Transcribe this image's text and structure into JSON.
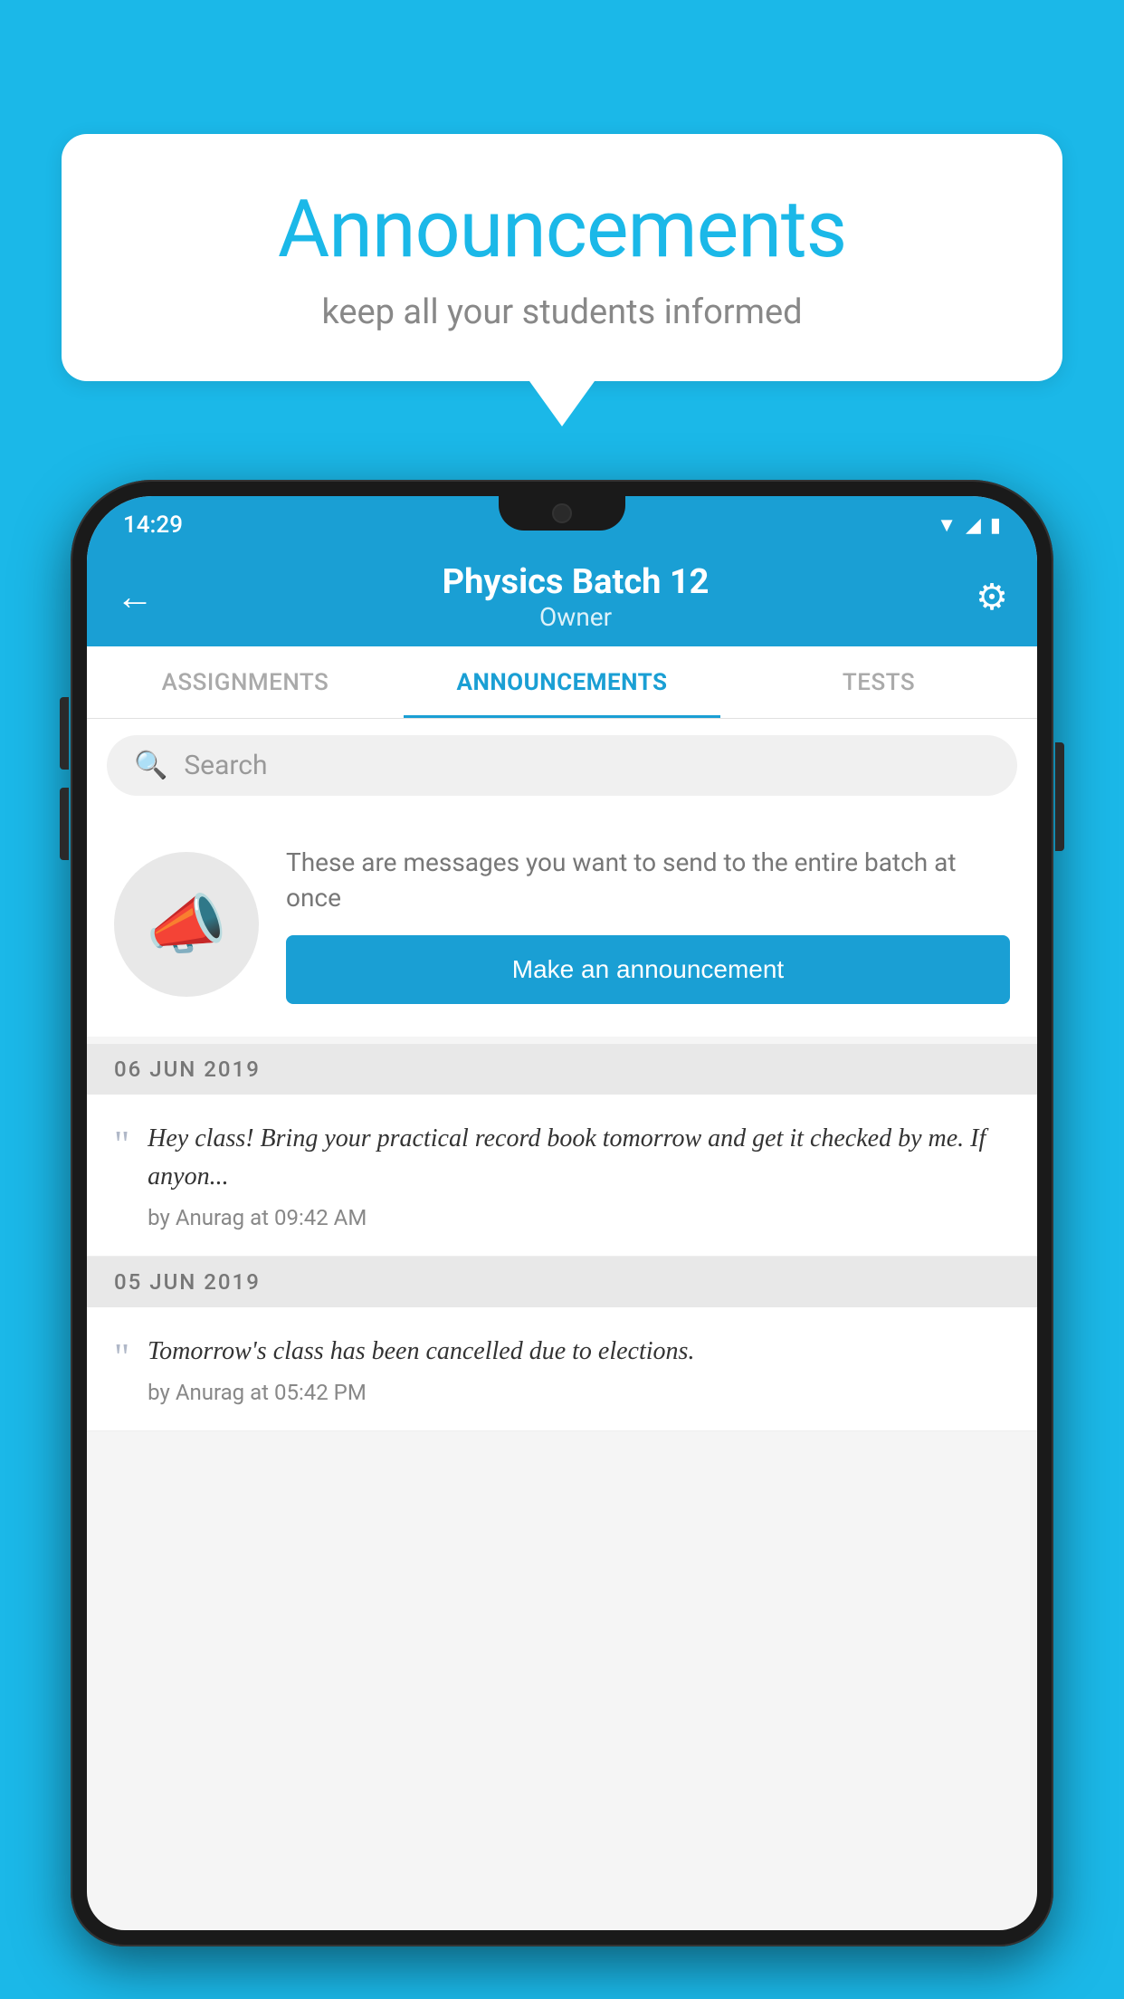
{
  "background_color": "#1bb8e8",
  "speech_bubble": {
    "title": "Announcements",
    "subtitle": "keep all your students informed"
  },
  "phone": {
    "status_bar": {
      "time": "14:29",
      "icons": [
        "wifi",
        "signal",
        "battery"
      ]
    },
    "app_bar": {
      "back_label": "←",
      "title": "Physics Batch 12",
      "subtitle": "Owner",
      "settings_label": "⚙"
    },
    "tabs": [
      {
        "label": "ASSIGNMENTS",
        "active": false
      },
      {
        "label": "ANNOUNCEMENTS",
        "active": true
      },
      {
        "label": "TESTS",
        "active": false
      },
      {
        "label": "...",
        "active": false
      }
    ],
    "search": {
      "placeholder": "Search"
    },
    "announcement_prompt": {
      "description": "These are messages you want to send to the entire batch at once",
      "button_label": "Make an announcement"
    },
    "announcements": [
      {
        "date": "06  JUN  2019",
        "text": "Hey class! Bring your practical record book tomorrow and get it checked by me. If anyon...",
        "meta": "by Anurag at 09:42 AM"
      },
      {
        "date": "05  JUN  2019",
        "text": "Tomorrow's class has been cancelled due to elections.",
        "meta": "by Anurag at 05:42 PM"
      }
    ]
  }
}
